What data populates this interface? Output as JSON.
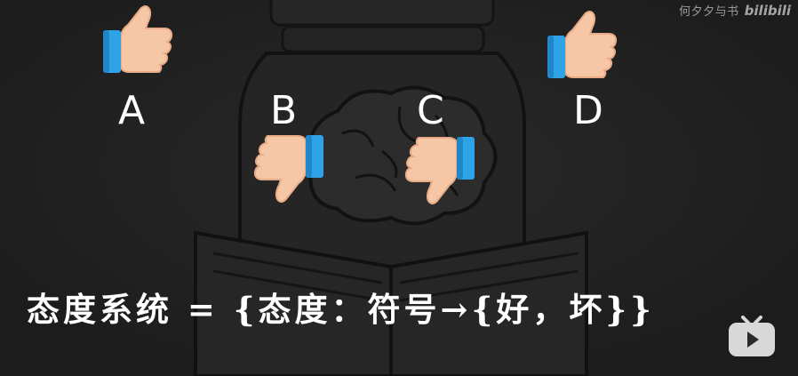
{
  "watermark": {
    "author": "何夕夕与书",
    "brand": "bilibili"
  },
  "options": [
    {
      "label": "A",
      "vote": "thumbs-up"
    },
    {
      "label": "B",
      "vote": "thumbs-down"
    },
    {
      "label": "C",
      "vote": "thumbs-down"
    },
    {
      "label": "D",
      "vote": "thumbs-up"
    }
  ],
  "formula": "态度系统 = {态度：符号→{好，坏}}",
  "colors": {
    "background": "#1f1f1f",
    "thumb_skin": "#f6c7a6",
    "thumb_cuff": "#2ea3e8",
    "text": "#ffffff"
  },
  "icons": [
    "thumbs-up-icon",
    "thumbs-down-icon",
    "video-play-icon"
  ]
}
